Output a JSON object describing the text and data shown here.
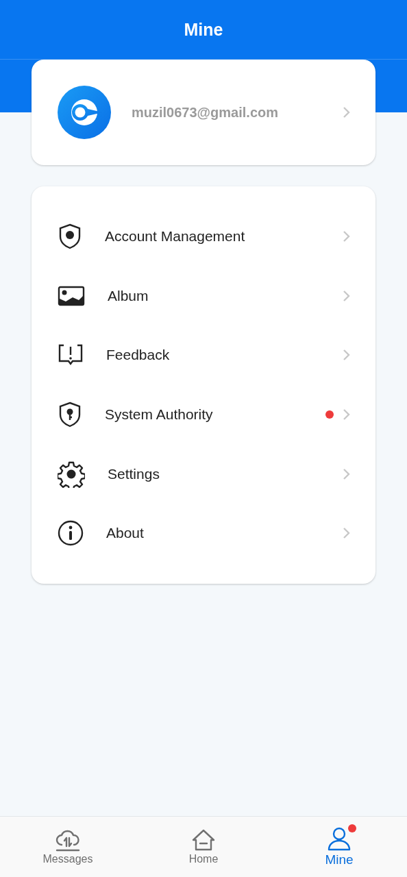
{
  "header": {
    "title": "Mine"
  },
  "profile": {
    "email": "muzil0673@gmail.com"
  },
  "menu": [
    {
      "kind": "shield",
      "label": "Account Management",
      "badge": false
    },
    {
      "kind": "image",
      "label": "Album",
      "badge": false
    },
    {
      "kind": "feedback",
      "label": "Feedback",
      "badge": false
    },
    {
      "kind": "key",
      "label": "System Authority",
      "badge": true
    },
    {
      "kind": "gear",
      "label": "Settings",
      "badge": false
    },
    {
      "kind": "info",
      "label": "About",
      "badge": false
    }
  ],
  "tabs": [
    {
      "kind": "cloud",
      "label": "Messages",
      "selected": false,
      "badge": false
    },
    {
      "kind": "home",
      "label": "Home",
      "selected": false,
      "badge": false
    },
    {
      "kind": "person",
      "label": "Mine",
      "selected": true,
      "badge": true
    }
  ]
}
